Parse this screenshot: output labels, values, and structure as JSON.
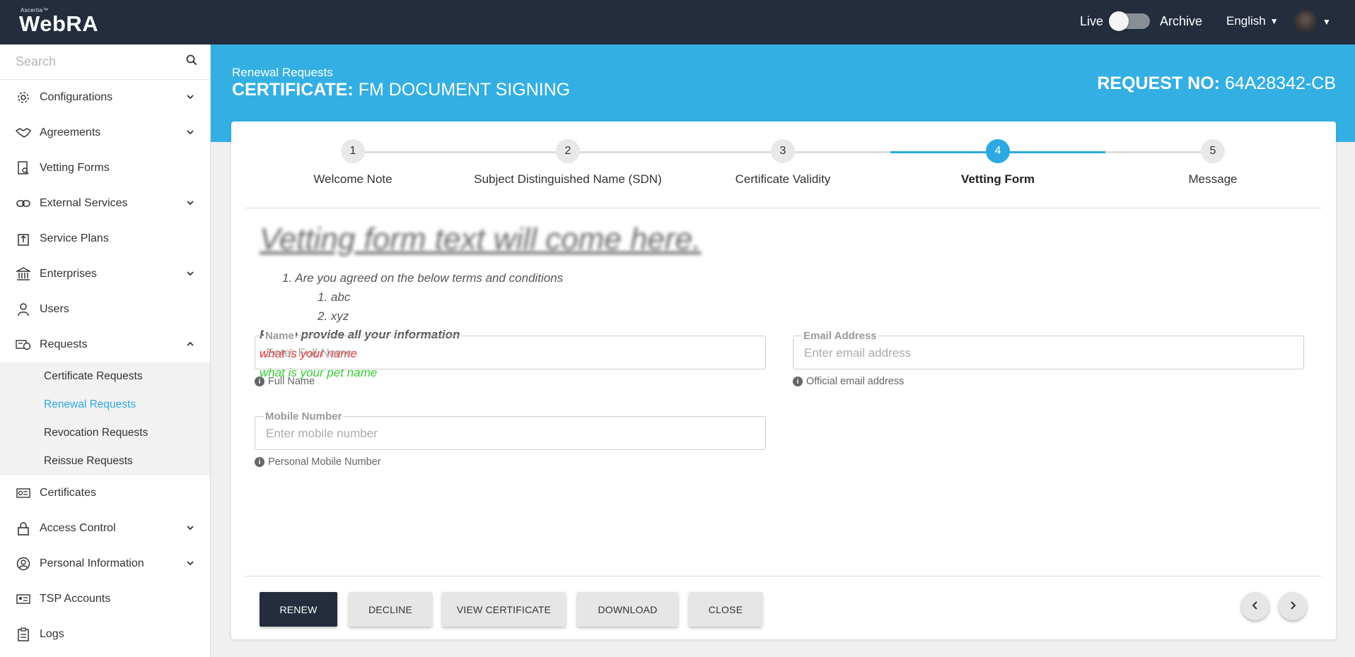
{
  "topbar": {
    "brand_small": "Ascertia™",
    "brand_name": "WebRA",
    "live_label": "Live",
    "archive_label": "Archive",
    "live_enabled": false,
    "language": "English"
  },
  "sidebar": {
    "search_placeholder": "Search",
    "items": [
      {
        "label": "Configurations",
        "icon": "gear-icon",
        "expandable": true
      },
      {
        "label": "Agreements",
        "icon": "handshake-icon",
        "expandable": true
      },
      {
        "label": "Vetting Forms",
        "icon": "document-search-icon",
        "expandable": false
      },
      {
        "label": "External Services",
        "icon": "link-icon",
        "expandable": true
      },
      {
        "label": "Service Plans",
        "icon": "upload-box-icon",
        "expandable": false
      },
      {
        "label": "Enterprises",
        "icon": "bank-icon",
        "expandable": true
      },
      {
        "label": "Users",
        "icon": "user-icon",
        "expandable": false
      },
      {
        "label": "Requests",
        "icon": "request-icon",
        "expandable": true,
        "expanded": true
      }
    ],
    "request_subitems": [
      {
        "label": "Certificate Requests",
        "active": false
      },
      {
        "label": "Renewal Requests",
        "active": true
      },
      {
        "label": "Revocation Requests",
        "active": false
      },
      {
        "label": "Reissue Requests",
        "active": false
      }
    ],
    "items_after": [
      {
        "label": "Certificates",
        "icon": "certificate-icon",
        "expandable": false
      },
      {
        "label": "Access Control",
        "icon": "lock-icon",
        "expandable": true
      },
      {
        "label": "Personal Information",
        "icon": "user-circle-icon",
        "expandable": true
      },
      {
        "label": "TSP Accounts",
        "icon": "id-card-icon",
        "expandable": false
      },
      {
        "label": "Logs",
        "icon": "clipboard-icon",
        "expandable": false
      }
    ]
  },
  "banner": {
    "breadcrumb": "Renewal Requests",
    "title_prefix": "CERTIFICATE:",
    "title_value": "FM DOCUMENT SIGNING",
    "request_prefix": "REQUEST NO:",
    "request_value": "64A28342-CB"
  },
  "stepper": {
    "steps": [
      {
        "number": "1",
        "label": "Welcome Note"
      },
      {
        "number": "2",
        "label": "Subject Distinguished Name (SDN)"
      },
      {
        "number": "3",
        "label": "Certificate Validity"
      },
      {
        "number": "4",
        "label": "Vetting Form"
      },
      {
        "number": "5",
        "label": "Message"
      }
    ],
    "active_index": 3
  },
  "vetting": {
    "heading": "Vetting form text will come here.",
    "item1": "Are you agreed on the below terms and conditions",
    "sub1": "abc",
    "sub2": "xyz",
    "bold_line": "Please provide all your information",
    "red_line": "what is your name",
    "green_line": "what is your pet name",
    "colors": {
      "red": "#ee2c2c",
      "green": "#35cc35"
    }
  },
  "form": {
    "name": {
      "label": "Name",
      "placeholder": "Enter Full Name",
      "value": "",
      "hint": "Full Name"
    },
    "email": {
      "label": "Email Address",
      "placeholder": "Enter email address",
      "value": "",
      "hint": "Official email address"
    },
    "mobile": {
      "label": "Mobile Number",
      "placeholder": "Enter mobile number",
      "value": "",
      "hint": "Personal Mobile Number"
    }
  },
  "actions": {
    "renew": "RENEW",
    "decline": "DECLINE",
    "view_certificate": "VIEW CERTIFICATE",
    "download": "DOWNLOAD",
    "close": "CLOSE"
  },
  "colors": {
    "topbar": "#232d3d",
    "accent": "#33afe3",
    "primary_button": "#232d3d"
  }
}
